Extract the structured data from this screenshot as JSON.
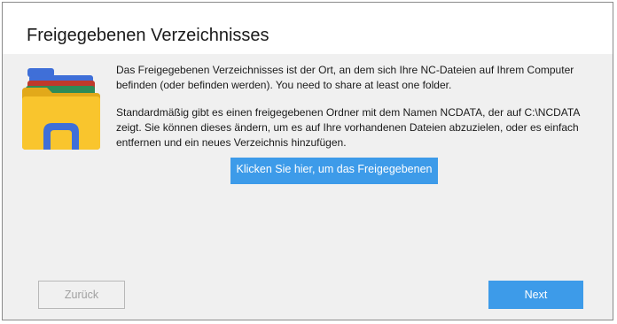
{
  "dialog": {
    "title": "Freigegebenen Verzeichnisses",
    "icon": "folder-icon",
    "paragraph_1": "Das Freigegebenen Verzeichnisses ist der Ort, an dem sich Ihre NC-Dateien auf Ihrem Computer befinden (oder befinden werden). You need to share at least one folder.",
    "paragraph_2": "Standardmäßig gibt es einen freigegebenen Ordner mit dem Namen NCDATA, der auf C:\\NCDATA zeigt. Sie können dieses ändern, um es auf Ihre vorhandenen Dateien abzuzielen, oder es einfach entfernen und ein neues Verzeichnis hinzufügen.",
    "share_button_label": "Klicken Sie hier, um das Freigegebenen"
  },
  "footer": {
    "back_label": "Zurück",
    "back_enabled": false,
    "next_label": "Next"
  },
  "colors": {
    "accent": "#3d9be9",
    "content_bg": "#f0f0f0",
    "folder_yellow": "#f9c52d",
    "folder_dark_yellow": "#e2a91a",
    "folder_blue": "#3f6fd8",
    "folder_red": "#c0392b",
    "folder_green": "#2e8b57"
  }
}
